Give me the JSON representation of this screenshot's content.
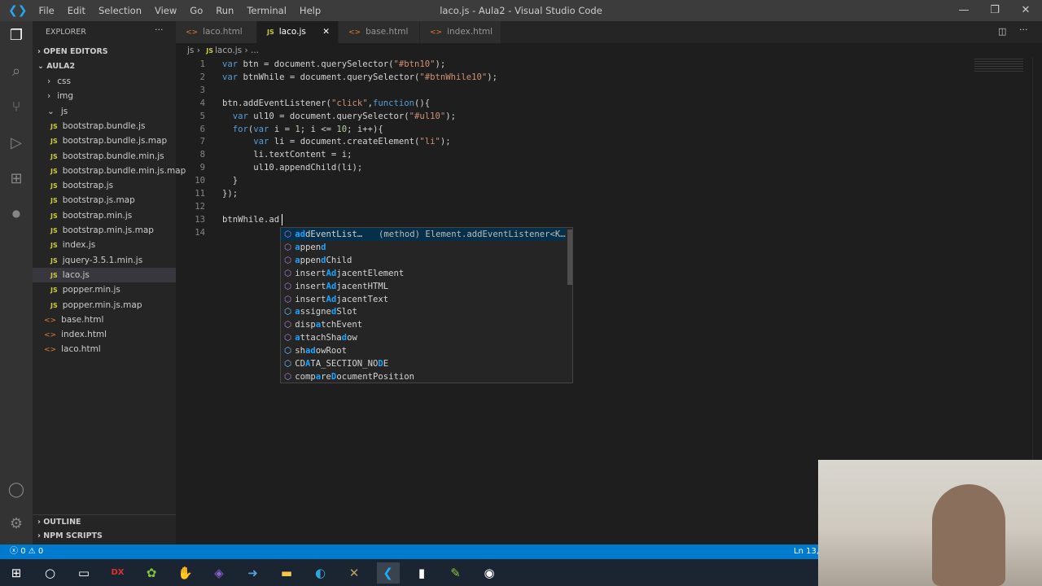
{
  "titlebar": {
    "menus": [
      "File",
      "Edit",
      "Selection",
      "View",
      "Go",
      "Run",
      "Terminal",
      "Help"
    ],
    "title": "laco.js - Aula2 - Visual Studio Code"
  },
  "activity": [
    "files-icon",
    "search-icon",
    "source-control-icon",
    "run-debug-icon",
    "extensions-icon",
    "remote-icon",
    "account-icon",
    "settings-gear-icon"
  ],
  "sidebar": {
    "header": "EXPLORER",
    "open_editors": "OPEN EDITORS",
    "folder": "AULA2",
    "items": [
      {
        "label": "css",
        "type": "folder",
        "depth": 1
      },
      {
        "label": "img",
        "type": "folder",
        "depth": 1
      },
      {
        "label": "js",
        "type": "folder-open",
        "depth": 1
      },
      {
        "label": "bootstrap.bundle.js",
        "type": "js",
        "depth": 2
      },
      {
        "label": "bootstrap.bundle.js.map",
        "type": "js",
        "depth": 2
      },
      {
        "label": "bootstrap.bundle.min.js",
        "type": "js",
        "depth": 2
      },
      {
        "label": "bootstrap.bundle.min.js.map",
        "type": "js",
        "depth": 2
      },
      {
        "label": "bootstrap.js",
        "type": "js",
        "depth": 2
      },
      {
        "label": "bootstrap.js.map",
        "type": "js",
        "depth": 2
      },
      {
        "label": "bootstrap.min.js",
        "type": "js",
        "depth": 2
      },
      {
        "label": "bootstrap.min.js.map",
        "type": "js",
        "depth": 2
      },
      {
        "label": "index.js",
        "type": "js",
        "depth": 2
      },
      {
        "label": "jquery-3.5.1.min.js",
        "type": "js",
        "depth": 2
      },
      {
        "label": "laco.js",
        "type": "js",
        "depth": 2,
        "selected": true
      },
      {
        "label": "popper.min.js",
        "type": "js",
        "depth": 2
      },
      {
        "label": "popper.min.js.map",
        "type": "js",
        "depth": 2
      },
      {
        "label": "base.html",
        "type": "html",
        "depth": 1
      },
      {
        "label": "index.html",
        "type": "html",
        "depth": 1
      },
      {
        "label": "laco.html",
        "type": "html",
        "depth": 1
      }
    ],
    "outline": "OUTLINE",
    "npm": "NPM SCRIPTS"
  },
  "tabs": [
    {
      "label": "laco.html",
      "type": "html"
    },
    {
      "label": "laco.js",
      "type": "js",
      "active": true
    },
    {
      "label": "base.html",
      "type": "html"
    },
    {
      "label": "index.html",
      "type": "html"
    }
  ],
  "breadcrumb": [
    "js",
    "laco.js",
    "..."
  ],
  "code": [
    [
      [
        "var",
        "kw"
      ],
      [
        " btn = document.querySelector(",
        ""
      ],
      [
        "\"#btn10\"",
        "str"
      ],
      [
        ");",
        ""
      ]
    ],
    [
      [
        "var",
        "kw"
      ],
      [
        " btnWhile = document.querySelector(",
        ""
      ],
      [
        "\"#btnWhile10\"",
        "str"
      ],
      [
        ");",
        ""
      ]
    ],
    [],
    [
      [
        "btn.addEventListener(",
        ""
      ],
      [
        "\"click\"",
        "str"
      ],
      [
        ",",
        ""
      ],
      [
        "function",
        "kw"
      ],
      [
        "(){",
        ""
      ]
    ],
    [
      [
        "  ",
        ""
      ],
      [
        "var",
        "kw"
      ],
      [
        " ul10 = document.querySelector(",
        ""
      ],
      [
        "\"#ul10\"",
        "str"
      ],
      [
        ");",
        ""
      ]
    ],
    [
      [
        "  ",
        ""
      ],
      [
        "for",
        "kw"
      ],
      [
        "(",
        ""
      ],
      [
        "var",
        "kw"
      ],
      [
        " i = ",
        ""
      ],
      [
        "1",
        "num"
      ],
      [
        "; i <= ",
        ""
      ],
      [
        "10",
        "num"
      ],
      [
        "; i++){",
        ""
      ]
    ],
    [
      [
        "      ",
        ""
      ],
      [
        "var",
        "kw"
      ],
      [
        " li = document.createElement(",
        ""
      ],
      [
        "\"li\"",
        "str"
      ],
      [
        ");",
        ""
      ]
    ],
    [
      [
        "      li.textContent = i;",
        ""
      ]
    ],
    [
      [
        "      ul10.appendChild(li);",
        ""
      ]
    ],
    [
      [
        "  }",
        ""
      ]
    ],
    [
      [
        "});",
        ""
      ]
    ],
    [],
    [
      [
        "btnWhile.ad",
        ""
      ]
    ],
    []
  ],
  "suggest": {
    "detail": "(method) Element.addEventListener<K…",
    "items": [
      {
        "parts": [
          [
            "ad",
            1
          ],
          [
            "dEventList…",
            0
          ]
        ],
        "kind": "method"
      },
      {
        "parts": [
          [
            "a",
            1
          ],
          [
            "ppen",
            0
          ],
          [
            "d",
            1
          ]
        ],
        "kind": "method"
      },
      {
        "parts": [
          [
            "a",
            1
          ],
          [
            "ppen",
            0
          ],
          [
            "d",
            1
          ],
          [
            "Child",
            0
          ]
        ],
        "kind": "method"
      },
      {
        "parts": [
          [
            "insert",
            0
          ],
          [
            "Ad",
            1
          ],
          [
            "jacentElement",
            0
          ]
        ],
        "kind": "method"
      },
      {
        "parts": [
          [
            "insert",
            0
          ],
          [
            "Ad",
            1
          ],
          [
            "jacentHTML",
            0
          ]
        ],
        "kind": "method"
      },
      {
        "parts": [
          [
            "insert",
            0
          ],
          [
            "Ad",
            1
          ],
          [
            "jacentText",
            0
          ]
        ],
        "kind": "method"
      },
      {
        "parts": [
          [
            "a",
            1
          ],
          [
            "ssigne",
            0
          ],
          [
            "d",
            1
          ],
          [
            "Slot",
            0
          ]
        ],
        "kind": "field"
      },
      {
        "parts": [
          [
            "disp",
            0
          ],
          [
            "a",
            1
          ],
          [
            "tchEvent",
            0
          ]
        ],
        "kind": "method"
      },
      {
        "parts": [
          [
            "a",
            1
          ],
          [
            "ttachSha",
            0
          ],
          [
            "d",
            1
          ],
          [
            "ow",
            0
          ]
        ],
        "kind": "method"
      },
      {
        "parts": [
          [
            "sh",
            0
          ],
          [
            "ad",
            1
          ],
          [
            "owRoot",
            0
          ]
        ],
        "kind": "field"
      },
      {
        "parts": [
          [
            "CD",
            0
          ],
          [
            "A",
            1
          ],
          [
            "TA_SECTION_NO",
            0
          ],
          [
            "D",
            1
          ],
          [
            "E",
            0
          ]
        ],
        "kind": "field"
      },
      {
        "parts": [
          [
            "comp",
            0
          ],
          [
            "a",
            1
          ],
          [
            "re",
            0
          ],
          [
            "D",
            1
          ],
          [
            "ocumentPosition",
            0
          ]
        ],
        "kind": "method"
      }
    ]
  },
  "status": {
    "errors": "0",
    "warnings": "0",
    "position": "Ln 13, C"
  },
  "taskbar": [
    "windows-start-icon",
    "search-circle-icon",
    "task-view-icon",
    "devexpress-icon",
    "app-icon",
    "app-icon-2",
    "visual-studio-icon",
    "powershell-icon",
    "file-explorer-icon",
    "edge-icon",
    "app-icon-3",
    "vscode-icon",
    "trello-icon",
    "notepad-icon",
    "obs-icon"
  ],
  "colors": {
    "accent": "#007acc",
    "keyword": "#569cd6",
    "string": "#ce9178",
    "number": "#b5cea8"
  }
}
